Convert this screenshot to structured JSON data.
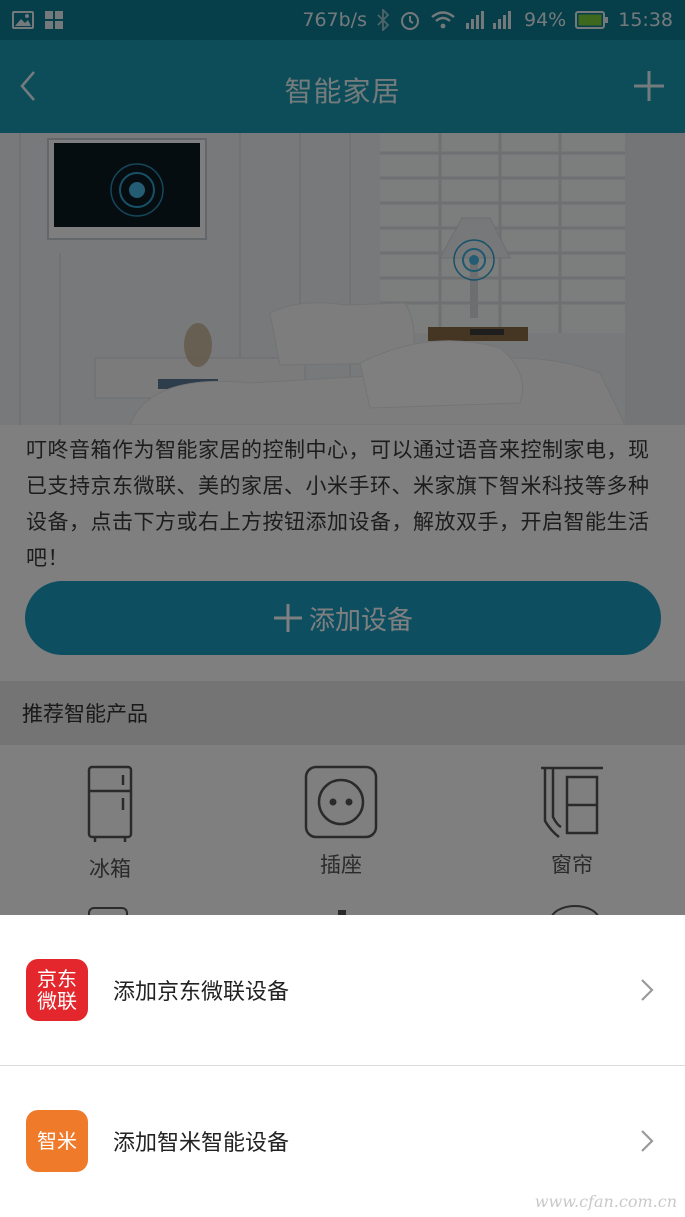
{
  "status_bar": {
    "net_speed": "767b/s",
    "battery": "94%",
    "time": "15:38",
    "icons": [
      "gallery-icon",
      "apps-icon",
      "bluetooth-icon",
      "alarm-icon",
      "wifi-icon",
      "signal-icon",
      "battery-icon"
    ]
  },
  "header": {
    "title": "智能家居",
    "back_icon": "chevron-left-icon",
    "add_icon": "plus-icon"
  },
  "intro": {
    "text": "叮咚音箱作为智能家居的控制中心，可以通过语音来控制家电，现已支持京东微联、美的家居、小米手环、米家旗下智米科技等多种设备，点击下方或右上方按钮添加设备，解放双手，开启智能生活吧！"
  },
  "add_button": {
    "label": "添加设备"
  },
  "recommended": {
    "title": "推荐智能产品",
    "items": [
      {
        "label": "冰箱",
        "icon": "fridge-icon"
      },
      {
        "label": "插座",
        "icon": "socket-icon"
      },
      {
        "label": "窗帘",
        "icon": "curtain-icon"
      }
    ]
  },
  "sheet": {
    "options": [
      {
        "logo_line1": "京东",
        "logo_line2": "微联",
        "label": "添加京东微联设备",
        "color": "#e3272c"
      },
      {
        "logo_line1": "智米",
        "logo_line2": "",
        "label": "添加智米智能设备",
        "color": "#ef7a2a"
      }
    ]
  },
  "watermark": "www.cfan.com.cn",
  "colors": {
    "primary": "#1b9bb5",
    "status_bar": "#0d7e94",
    "button": "#1c9dc2"
  }
}
